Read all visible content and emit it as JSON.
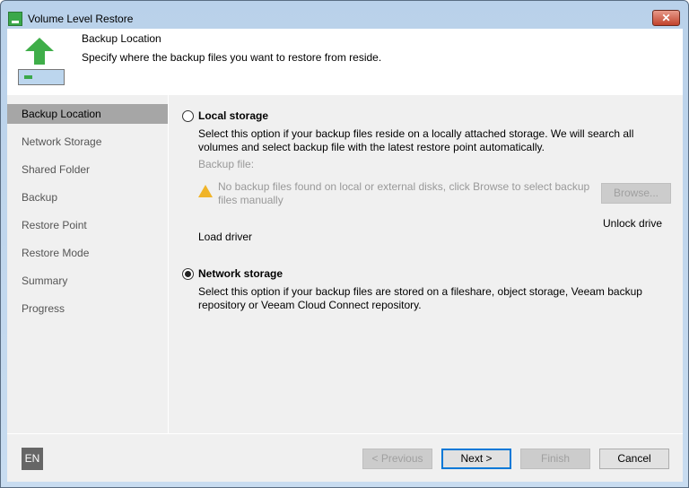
{
  "window": {
    "title": "Volume Level Restore",
    "close": "✕"
  },
  "header": {
    "title": "Backup Location",
    "subtitle": "Specify where the backup files you want to restore from reside."
  },
  "sidebar": {
    "items": [
      {
        "label": "Backup Location",
        "selected": true
      },
      {
        "label": "Network Storage"
      },
      {
        "label": "Shared Folder"
      },
      {
        "label": "Backup"
      },
      {
        "label": "Restore Point"
      },
      {
        "label": "Restore Mode"
      },
      {
        "label": "Summary"
      },
      {
        "label": "Progress"
      }
    ]
  },
  "local": {
    "label": "Local storage",
    "selected": false,
    "desc": "Select this option if your backup files reside on a locally attached storage. We will search all volumes and select backup file with the latest restore point automatically.",
    "backup_file_label": "Backup file:",
    "warning": "No backup files found on local or external disks, click Browse to select backup files manually",
    "browse": "Browse...",
    "unlock": "Unlock drive",
    "load_driver": "Load driver"
  },
  "network": {
    "label": "Network storage",
    "selected": true,
    "desc": "Select this option if your backup files are stored on a fileshare, object storage, Veeam backup repository or Veeam Cloud Connect repository."
  },
  "footer": {
    "lang": "EN",
    "previous": "< Previous",
    "next": "Next >",
    "finish": "Finish",
    "cancel": "Cancel"
  }
}
